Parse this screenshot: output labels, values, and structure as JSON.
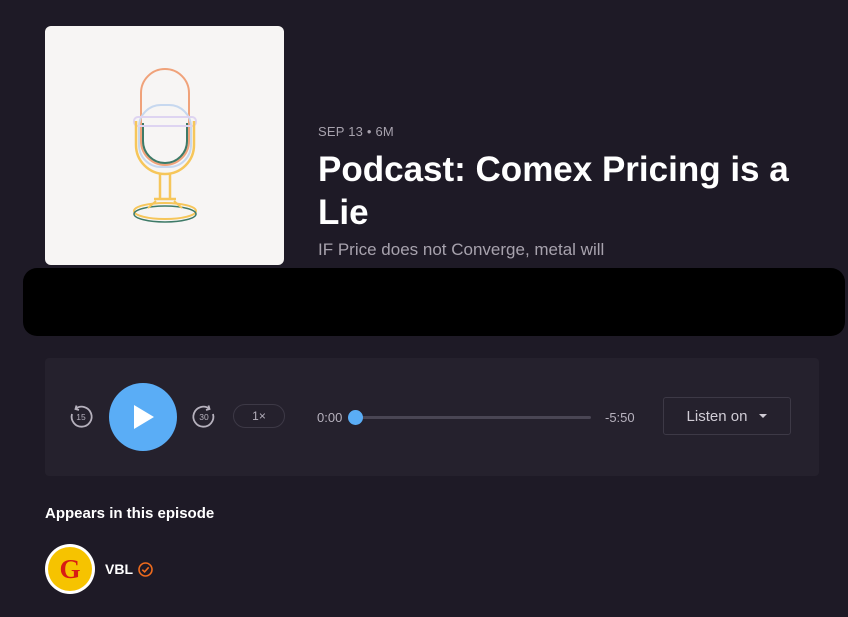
{
  "episode": {
    "date": "SEP 13",
    "separator": "•",
    "duration": "6M",
    "title": "Podcast: Comex Pricing is a Lie",
    "description": "IF Price does not Converge, metal will"
  },
  "player": {
    "skip_back_seconds": "15",
    "skip_forward_seconds": "30",
    "speed": "1×",
    "current_time": "0:00",
    "remaining_time": "-5:50",
    "progress_fraction": 0.0,
    "listen_on_label": "Listen on",
    "accent_color": "#5aadf6"
  },
  "appears": {
    "heading": "Appears in this episode",
    "people": [
      {
        "name": "VBL",
        "avatar_letter": "G",
        "verified": true
      }
    ]
  },
  "icons": {
    "cover": "microphone-icon",
    "skip_back": "rewind-15-icon",
    "play": "play-icon",
    "skip_forward": "forward-30-icon",
    "caret": "chevron-down-icon",
    "verified": "verified-check-icon"
  },
  "colors": {
    "background": "#1e1a26",
    "player_background": "#25212d",
    "verified": "#ef6b1d"
  }
}
